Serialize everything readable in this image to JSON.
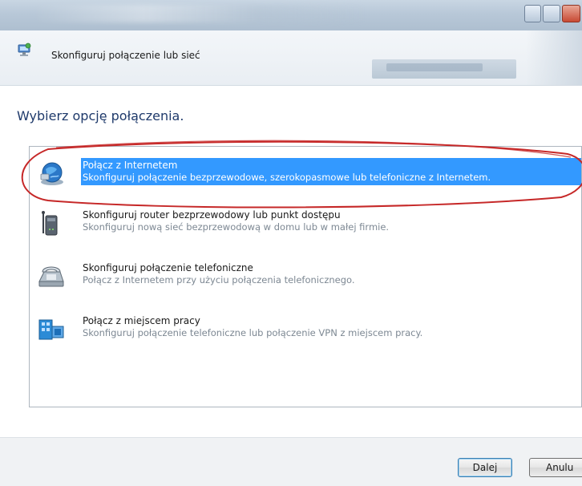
{
  "window": {
    "title": "Skonfiguruj połączenie lub sieć"
  },
  "heading": "Wybierz opcję połączenia.",
  "options": [
    {
      "title": "Połącz z Internetem",
      "description": "Skonfiguruj połączenie bezprzewodowe, szerokopasmowe lub telefoniczne z Internetem.",
      "icon": "globe-network-icon",
      "selected": true
    },
    {
      "title": "Skonfiguruj router bezprzewodowy lub punkt dostępu",
      "description": "Skonfiguruj nową sieć bezprzewodową w domu lub w małej firmie.",
      "icon": "wireless-router-icon",
      "selected": false
    },
    {
      "title": "Skonfiguruj połączenie telefoniczne",
      "description": "Połącz z Internetem przy użyciu połączenia telefonicznego.",
      "icon": "telephone-icon",
      "selected": false
    },
    {
      "title": "Połącz z miejscem pracy",
      "description": "Skonfiguruj połączenie telefoniczne lub połączenie VPN z miejscem pracy.",
      "icon": "workplace-network-icon",
      "selected": false
    }
  ],
  "buttons": {
    "next_label": "Dalej",
    "cancel_label": "Anulu"
  },
  "colors": {
    "selection": "#3399ff",
    "heading": "#1f3a6b",
    "annotation": "#c62828"
  }
}
